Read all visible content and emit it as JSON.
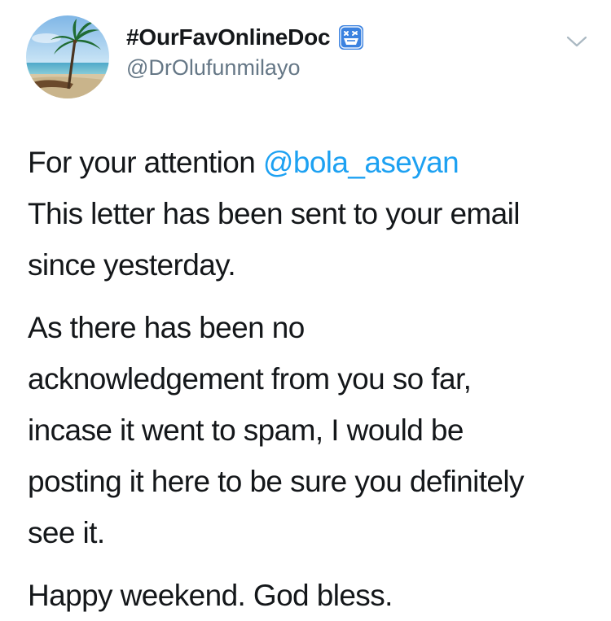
{
  "user": {
    "display_name": "#OurFavOnlineDoc",
    "handle": "@DrOlufunmilayo",
    "avatar_icon": "palm-tree-beach-avatar",
    "badge_icon": "emoji-badge-icon"
  },
  "actions": {
    "menu_icon": "chevron-down-icon"
  },
  "tweet": {
    "paragraphs": [
      {
        "lines": [
          {
            "text": "For your attention ",
            "mention": "@bola_aseyan"
          },
          {
            "text": "This letter has been sent to your email"
          },
          {
            "text": "since yesterday."
          }
        ]
      },
      {
        "lines": [
          {
            "text": "As there has been no"
          },
          {
            "text": "acknowledgement from you so far,"
          },
          {
            "text": "incase it went to spam, I would be"
          },
          {
            "text": "posting it here to be sure you definitely"
          },
          {
            "text": "see it."
          }
        ]
      },
      {
        "lines": [
          {
            "text": "Happy weekend. God bless."
          }
        ]
      }
    ]
  },
  "colors": {
    "text": "#14171a",
    "secondary": "#657786",
    "link": "#1da1f2",
    "badge_blue": "#3b82e0"
  }
}
